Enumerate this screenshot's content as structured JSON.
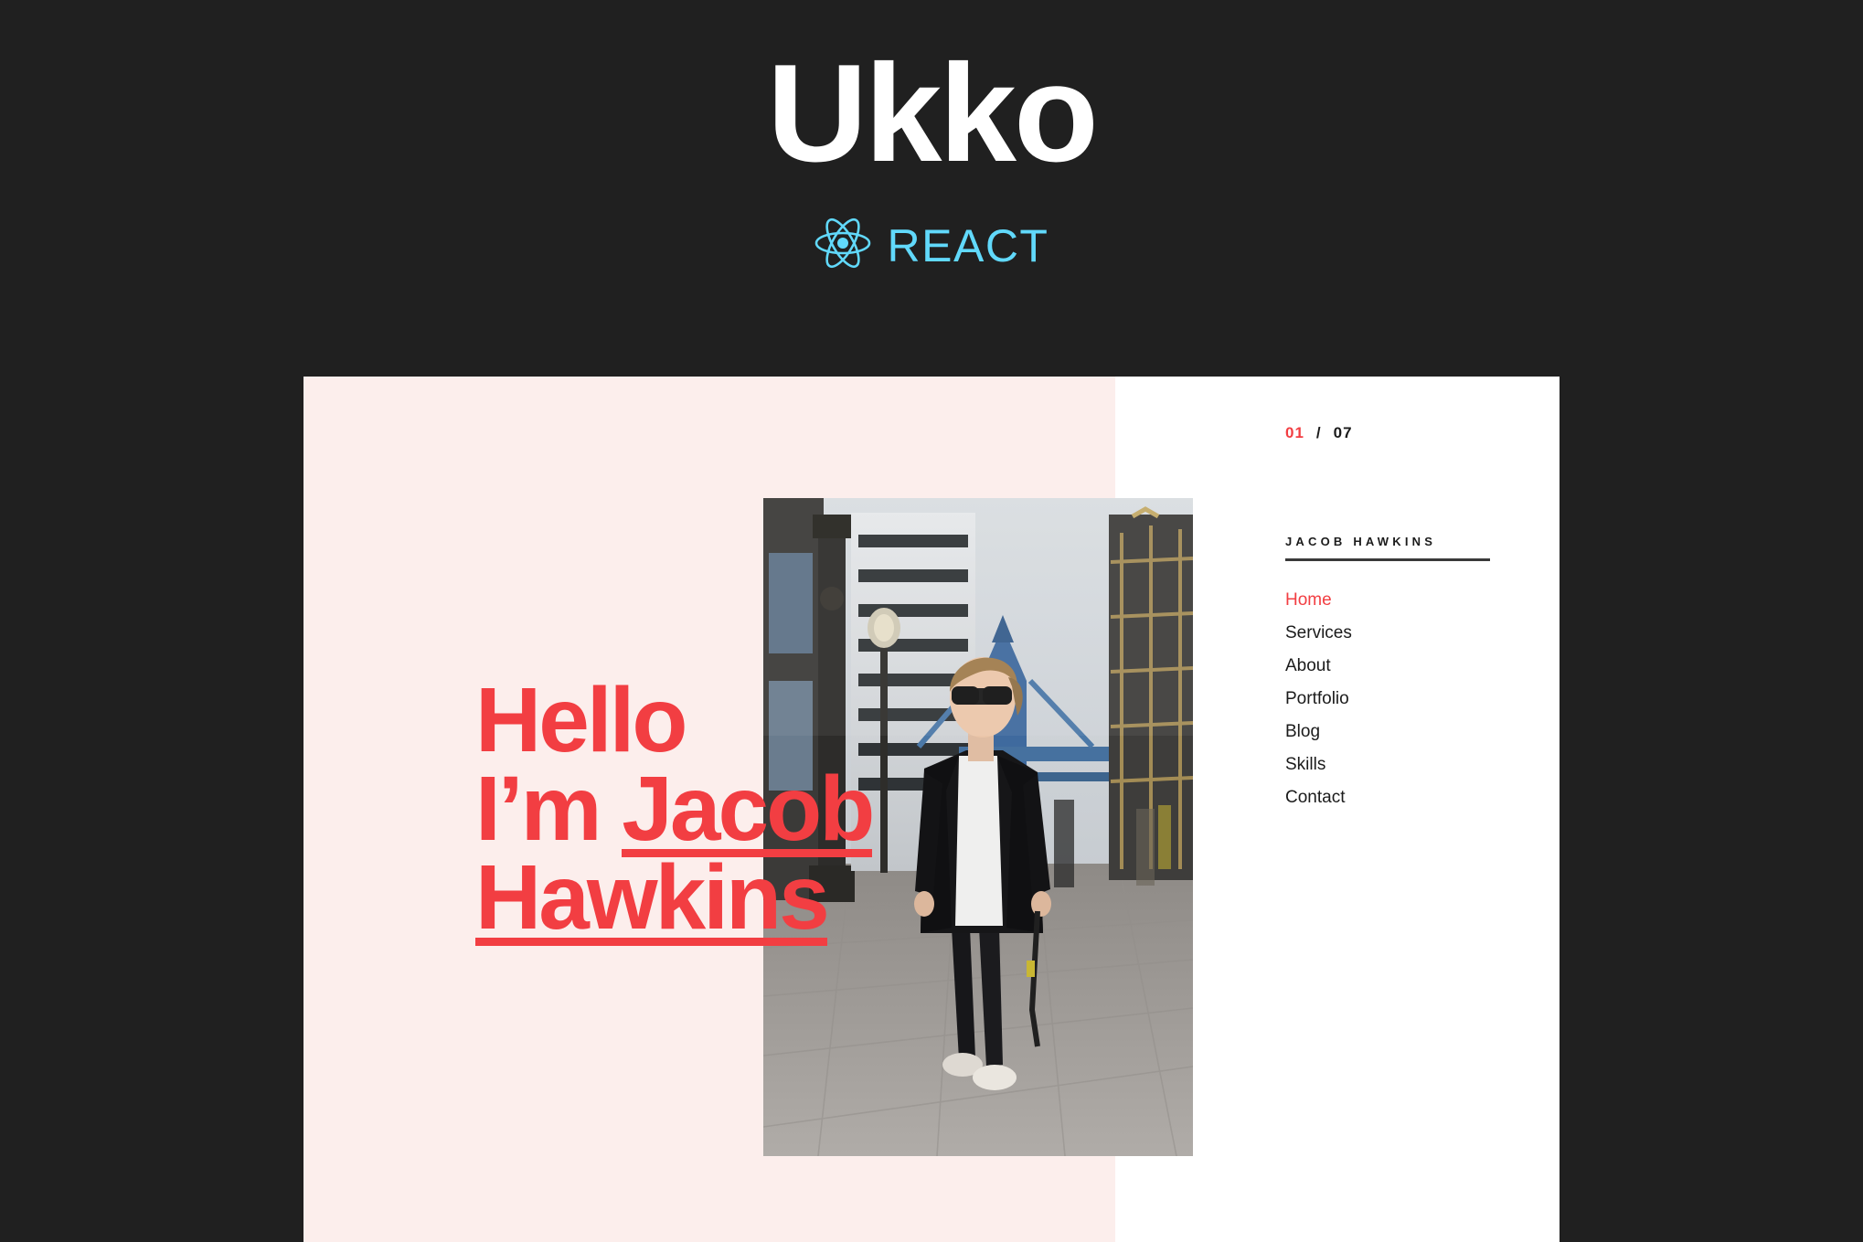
{
  "brand": {
    "title": "Ukko",
    "framework_label": "REACT",
    "framework_icon": "react-atom-icon",
    "accent_blue": "#61d9fb",
    "background": "#202020"
  },
  "colors": {
    "accent_red": "#f23e42",
    "panel_pink": "#fceeec",
    "panel_white": "#ffffff",
    "text_dark": "#1b1b1b"
  },
  "site": {
    "pagination": {
      "current": "01",
      "separator": "/",
      "total": "07"
    },
    "logo_name": "JACOB HAWKINS",
    "nav": [
      {
        "label": "Home",
        "active": true
      },
      {
        "label": "Services",
        "active": false
      },
      {
        "label": "About",
        "active": false
      },
      {
        "label": "Portfolio",
        "active": false
      },
      {
        "label": "Blog",
        "active": false
      },
      {
        "label": "Skills",
        "active": false
      },
      {
        "label": "Contact",
        "active": false
      }
    ],
    "hero": {
      "line1": "Hello",
      "line2_plain": "I’m ",
      "line2_underlined": "Jacob",
      "line3_underlined": "Hawkins",
      "photo_alt": "man-in-sunglasses-walking-city-street-photo"
    }
  }
}
